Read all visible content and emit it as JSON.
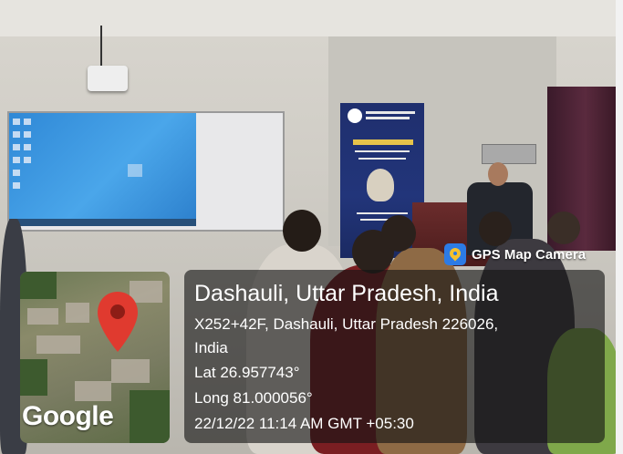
{
  "overlay": {
    "app_label": "GPS Map Camera",
    "location_title": "Dashauli, Uttar Pradesh, India",
    "address_line1": "X252+42F, Dashauli, Uttar Pradesh 226026,",
    "address_line2": "India",
    "latitude": "Lat 26.957743°",
    "longitude": "Long 81.000056°",
    "timestamp": "22/12/22 11:14 AM GMT +05:30"
  },
  "map_thumbnail": {
    "attribution": "Google",
    "pin_icon": "map-pin-icon"
  },
  "banner": {
    "lines": [
      "INTEGRAL",
      "UNIVERSITY",
      "MATHEMATICS DAY"
    ]
  },
  "colors": {
    "pin": "#e03a2f",
    "overlay_bg": "#141414",
    "banner_bg": "#22357a"
  }
}
